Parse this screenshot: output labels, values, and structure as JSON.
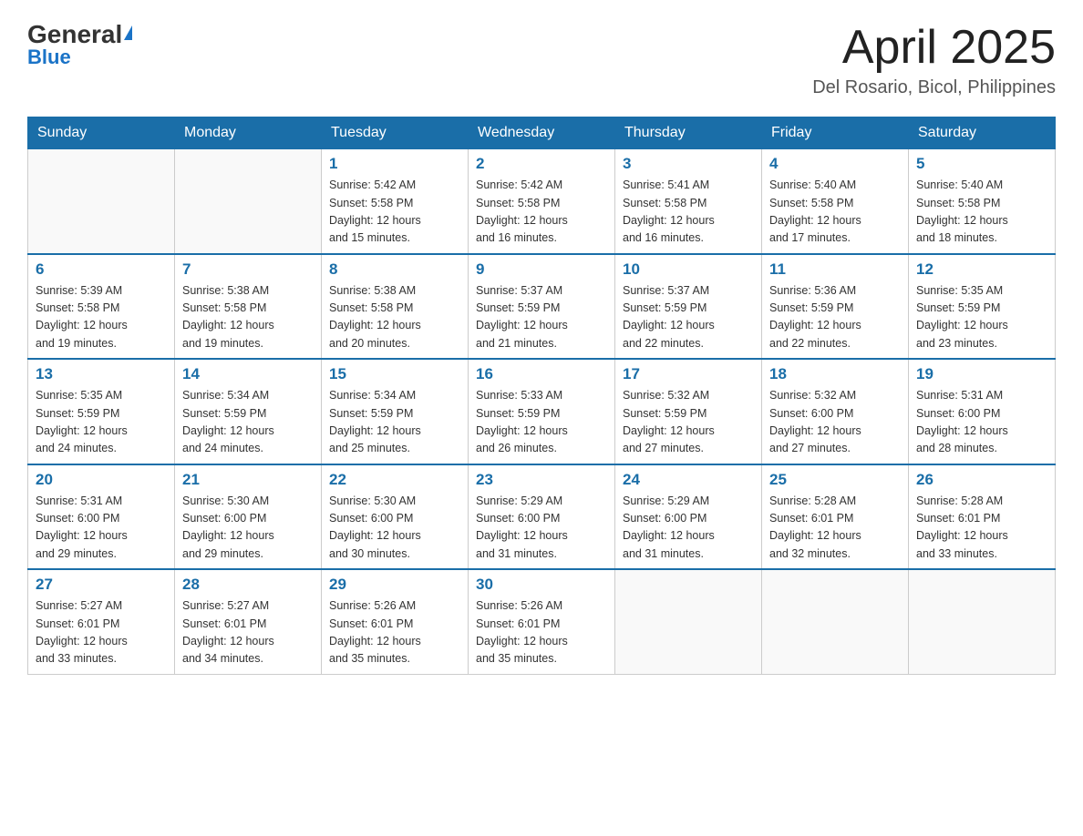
{
  "header": {
    "logo": {
      "general": "General",
      "blue": "Blue"
    },
    "title": "April 2025",
    "location": "Del Rosario, Bicol, Philippines"
  },
  "days_of_week": [
    "Sunday",
    "Monday",
    "Tuesday",
    "Wednesday",
    "Thursday",
    "Friday",
    "Saturday"
  ],
  "weeks": [
    [
      {
        "day": "",
        "info": ""
      },
      {
        "day": "",
        "info": ""
      },
      {
        "day": "1",
        "info": "Sunrise: 5:42 AM\nSunset: 5:58 PM\nDaylight: 12 hours\nand 15 minutes."
      },
      {
        "day": "2",
        "info": "Sunrise: 5:42 AM\nSunset: 5:58 PM\nDaylight: 12 hours\nand 16 minutes."
      },
      {
        "day": "3",
        "info": "Sunrise: 5:41 AM\nSunset: 5:58 PM\nDaylight: 12 hours\nand 16 minutes."
      },
      {
        "day": "4",
        "info": "Sunrise: 5:40 AM\nSunset: 5:58 PM\nDaylight: 12 hours\nand 17 minutes."
      },
      {
        "day": "5",
        "info": "Sunrise: 5:40 AM\nSunset: 5:58 PM\nDaylight: 12 hours\nand 18 minutes."
      }
    ],
    [
      {
        "day": "6",
        "info": "Sunrise: 5:39 AM\nSunset: 5:58 PM\nDaylight: 12 hours\nand 19 minutes."
      },
      {
        "day": "7",
        "info": "Sunrise: 5:38 AM\nSunset: 5:58 PM\nDaylight: 12 hours\nand 19 minutes."
      },
      {
        "day": "8",
        "info": "Sunrise: 5:38 AM\nSunset: 5:58 PM\nDaylight: 12 hours\nand 20 minutes."
      },
      {
        "day": "9",
        "info": "Sunrise: 5:37 AM\nSunset: 5:59 PM\nDaylight: 12 hours\nand 21 minutes."
      },
      {
        "day": "10",
        "info": "Sunrise: 5:37 AM\nSunset: 5:59 PM\nDaylight: 12 hours\nand 22 minutes."
      },
      {
        "day": "11",
        "info": "Sunrise: 5:36 AM\nSunset: 5:59 PM\nDaylight: 12 hours\nand 22 minutes."
      },
      {
        "day": "12",
        "info": "Sunrise: 5:35 AM\nSunset: 5:59 PM\nDaylight: 12 hours\nand 23 minutes."
      }
    ],
    [
      {
        "day": "13",
        "info": "Sunrise: 5:35 AM\nSunset: 5:59 PM\nDaylight: 12 hours\nand 24 minutes."
      },
      {
        "day": "14",
        "info": "Sunrise: 5:34 AM\nSunset: 5:59 PM\nDaylight: 12 hours\nand 24 minutes."
      },
      {
        "day": "15",
        "info": "Sunrise: 5:34 AM\nSunset: 5:59 PM\nDaylight: 12 hours\nand 25 minutes."
      },
      {
        "day": "16",
        "info": "Sunrise: 5:33 AM\nSunset: 5:59 PM\nDaylight: 12 hours\nand 26 minutes."
      },
      {
        "day": "17",
        "info": "Sunrise: 5:32 AM\nSunset: 5:59 PM\nDaylight: 12 hours\nand 27 minutes."
      },
      {
        "day": "18",
        "info": "Sunrise: 5:32 AM\nSunset: 6:00 PM\nDaylight: 12 hours\nand 27 minutes."
      },
      {
        "day": "19",
        "info": "Sunrise: 5:31 AM\nSunset: 6:00 PM\nDaylight: 12 hours\nand 28 minutes."
      }
    ],
    [
      {
        "day": "20",
        "info": "Sunrise: 5:31 AM\nSunset: 6:00 PM\nDaylight: 12 hours\nand 29 minutes."
      },
      {
        "day": "21",
        "info": "Sunrise: 5:30 AM\nSunset: 6:00 PM\nDaylight: 12 hours\nand 29 minutes."
      },
      {
        "day": "22",
        "info": "Sunrise: 5:30 AM\nSunset: 6:00 PM\nDaylight: 12 hours\nand 30 minutes."
      },
      {
        "day": "23",
        "info": "Sunrise: 5:29 AM\nSunset: 6:00 PM\nDaylight: 12 hours\nand 31 minutes."
      },
      {
        "day": "24",
        "info": "Sunrise: 5:29 AM\nSunset: 6:00 PM\nDaylight: 12 hours\nand 31 minutes."
      },
      {
        "day": "25",
        "info": "Sunrise: 5:28 AM\nSunset: 6:01 PM\nDaylight: 12 hours\nand 32 minutes."
      },
      {
        "day": "26",
        "info": "Sunrise: 5:28 AM\nSunset: 6:01 PM\nDaylight: 12 hours\nand 33 minutes."
      }
    ],
    [
      {
        "day": "27",
        "info": "Sunrise: 5:27 AM\nSunset: 6:01 PM\nDaylight: 12 hours\nand 33 minutes."
      },
      {
        "day": "28",
        "info": "Sunrise: 5:27 AM\nSunset: 6:01 PM\nDaylight: 12 hours\nand 34 minutes."
      },
      {
        "day": "29",
        "info": "Sunrise: 5:26 AM\nSunset: 6:01 PM\nDaylight: 12 hours\nand 35 minutes."
      },
      {
        "day": "30",
        "info": "Sunrise: 5:26 AM\nSunset: 6:01 PM\nDaylight: 12 hours\nand 35 minutes."
      },
      {
        "day": "",
        "info": ""
      },
      {
        "day": "",
        "info": ""
      },
      {
        "day": "",
        "info": ""
      }
    ]
  ]
}
